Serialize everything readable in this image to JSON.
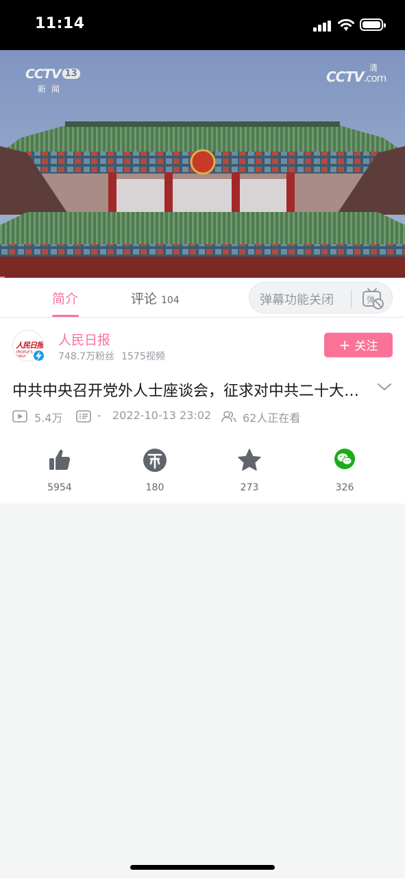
{
  "status_bar": {
    "time": "11:14"
  },
  "video": {
    "channel_logo": "CCTV",
    "channel_number": "13",
    "channel_sub": "新闻",
    "watermark": "CCTV",
    "watermark_suffix": ".com",
    "watermark_badge": "清"
  },
  "tabs": {
    "intro_label": "简介",
    "comments_label": "评论",
    "comments_count": "104",
    "danmaku_placeholder": "弹幕功能关闭",
    "danmaku_icon": "danmaku-off-icon"
  },
  "uploader": {
    "name": "人民日报",
    "avatar_text": "人民日报",
    "avatar_subtext": "PEOPLE'S DAILY",
    "fans": "748.7万粉丝",
    "videos": "1575视频",
    "follow_label": "关注"
  },
  "video_info": {
    "title": "中共中央召开党外人士座谈会，征求对中共二十大报告稿的意见",
    "views": "5.4万",
    "danmaku_count": "-",
    "publish_time": "2022-10-13 23:02",
    "watching": "62人正在看"
  },
  "actions": {
    "like": {
      "count": "5954",
      "icon": "thumbs-up-icon"
    },
    "coin": {
      "count": "180",
      "icon": "coin-icon"
    },
    "favorite": {
      "count": "273",
      "icon": "star-icon"
    },
    "share": {
      "count": "326",
      "icon": "wechat-icon"
    }
  },
  "colors": {
    "accent": "#fb7299",
    "text_primary": "#18191c",
    "text_secondary": "#9499a0",
    "background": "#f4f5f5"
  }
}
